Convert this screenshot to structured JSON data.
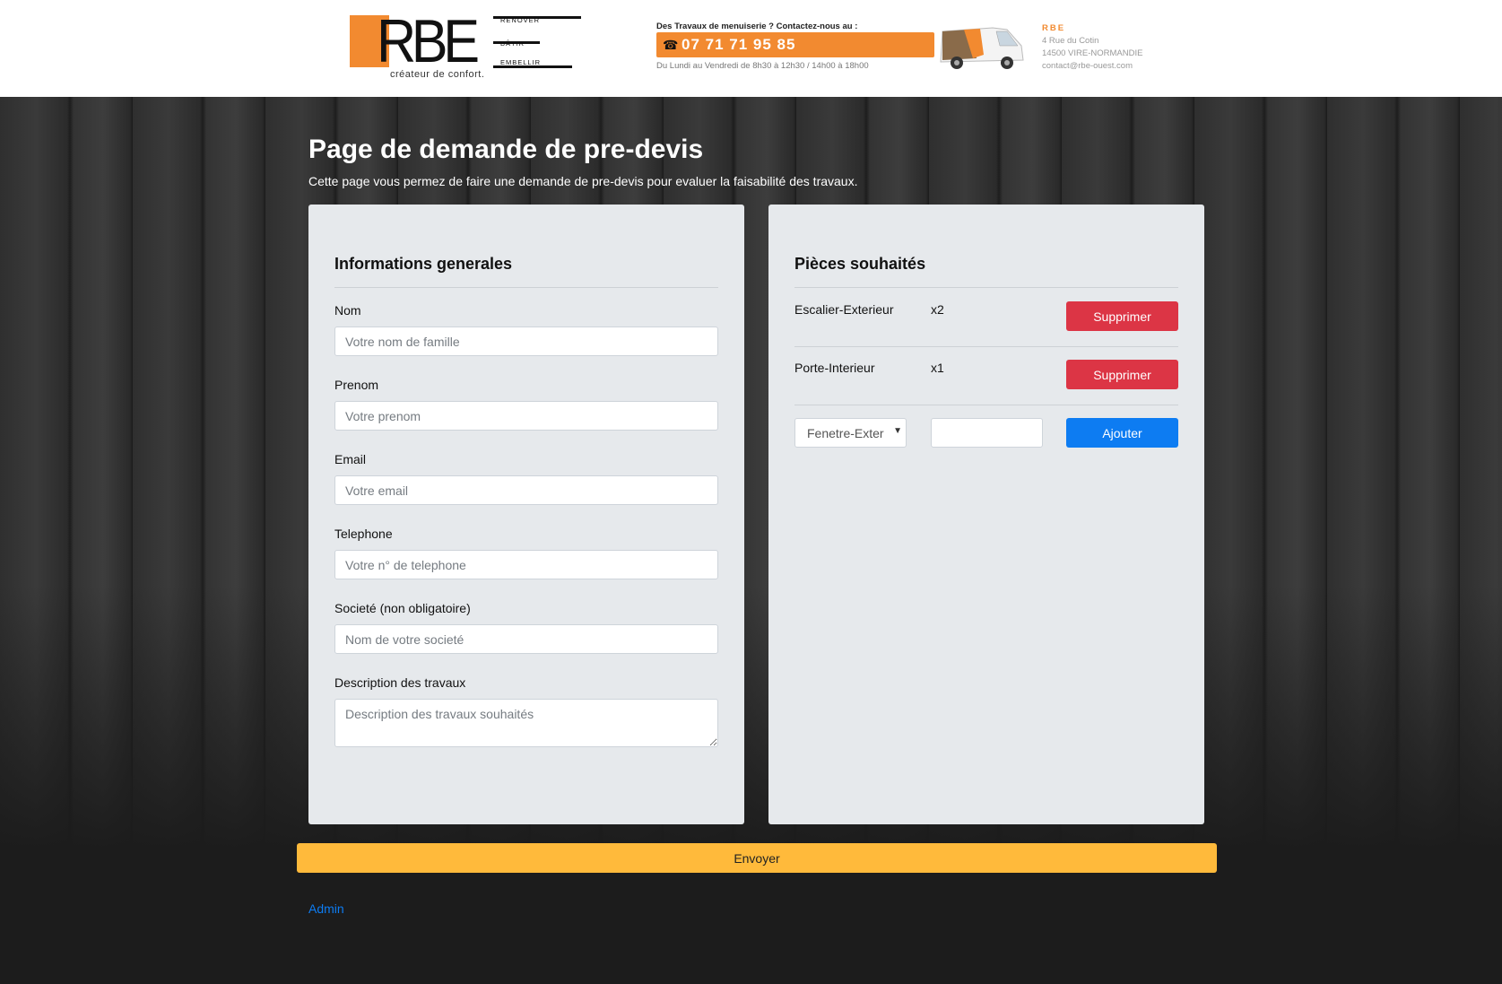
{
  "header": {
    "logo": {
      "letters": "RBE",
      "words": [
        "RÉNOVER",
        "BÂTIR",
        "EMBELLIR"
      ],
      "tagline": "créateur de confort."
    },
    "banner": {
      "top_text": "Des Travaux de menuiserie ? Contactez-nous au :",
      "phone": "07 71 71 95 85",
      "hours": "Du Lundi au Vendredi de 8h30 à 12h30 / 14h00 à 18h00"
    },
    "contact": {
      "name": "RBE",
      "street": "4 Rue du Cotin",
      "city": "14500 VIRE-NORMANDIE",
      "email": "contact@rbe-ouest.com"
    }
  },
  "page": {
    "title": "Page de demande de pre-devis",
    "subtitle": "Cette page vous permez de faire une demande de pre-devis pour evaluer la faisabilité des travaux."
  },
  "general": {
    "heading": "Informations generales",
    "fields": [
      {
        "label": "Nom",
        "placeholder": "Votre nom de famille",
        "value": ""
      },
      {
        "label": "Prenom",
        "placeholder": "Votre prenom",
        "value": ""
      },
      {
        "label": "Email",
        "placeholder": "Votre email",
        "value": ""
      },
      {
        "label": "Telephone",
        "placeholder": "Votre n° de telephone",
        "value": ""
      },
      {
        "label": "Societé (non obligatoire)",
        "placeholder": "Nom de votre societé",
        "value": ""
      },
      {
        "label": "Description des travaux",
        "placeholder": "Description des travaux souhaités",
        "value": ""
      }
    ]
  },
  "pieces": {
    "heading": "Pièces souhaités",
    "items": [
      {
        "name": "Escalier-Exterieur",
        "qty": "x2",
        "delete_label": "Supprimer"
      },
      {
        "name": "Porte-Interieur",
        "qty": "x1",
        "delete_label": "Supprimer"
      }
    ],
    "new_item": {
      "select_value": "Fenetre-Exter",
      "qty_value": "",
      "add_label": "Ajouter"
    }
  },
  "actions": {
    "send_label": "Envoyer",
    "admin_link": "Admin"
  },
  "colors": {
    "brand_orange": "#f28a30",
    "danger": "#dc3545",
    "primary": "#0d7cf2",
    "warning": "#ffba3b"
  }
}
